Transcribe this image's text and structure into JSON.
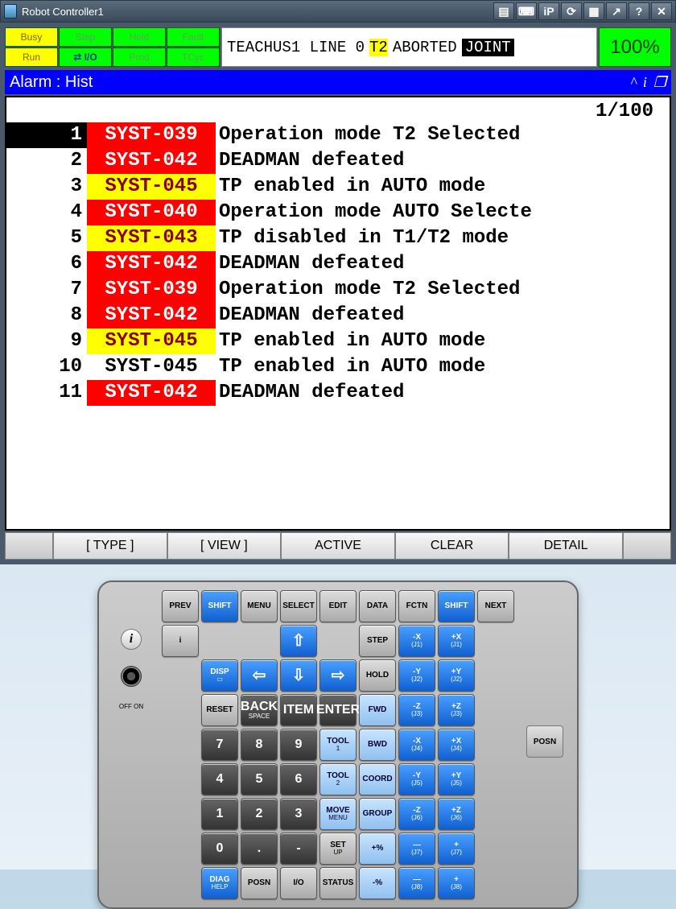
{
  "title": "Robot Controller1",
  "toolbar_icons": [
    "▤",
    "⌨",
    "iP",
    "⟳",
    "▦",
    "↗",
    "?",
    "✕"
  ],
  "status": {
    "grid": [
      {
        "label": "Busy",
        "cls": "yellow"
      },
      {
        "label": "Step",
        "cls": "dim"
      },
      {
        "label": "Hold",
        "cls": "dim"
      },
      {
        "label": "Fault",
        "cls": "dim"
      },
      {
        "label": "Run",
        "cls": "yellow"
      },
      {
        "label": "⇄ I/O",
        "cls": "active"
      },
      {
        "label": "Prod",
        "cls": "dim"
      },
      {
        "label": "TCyc",
        "cls": "dim"
      }
    ],
    "program": "TEACHUS1 LINE 0",
    "mode": "T2",
    "state": "ABORTED",
    "coord": "JOINT",
    "percent": "100%"
  },
  "header": "Alarm : Hist",
  "pager": "1/100",
  "alarms": [
    {
      "n": "1",
      "code": "SYST-039",
      "sev": "red",
      "msg": "Operation mode T2 Selected",
      "sel": true
    },
    {
      "n": "2",
      "code": "SYST-042",
      "sev": "red",
      "msg": "DEADMAN defeated"
    },
    {
      "n": "3",
      "code": "SYST-045",
      "sev": "yel",
      "msg": "TP enabled in AUTO mode"
    },
    {
      "n": "4",
      "code": "SYST-040",
      "sev": "red",
      "msg": "Operation mode AUTO Selecte"
    },
    {
      "n": "5",
      "code": "SYST-043",
      "sev": "yel",
      "msg": "TP disabled in T1/T2 mode"
    },
    {
      "n": "6",
      "code": "SYST-042",
      "sev": "red",
      "msg": "DEADMAN defeated"
    },
    {
      "n": "7",
      "code": "SYST-039",
      "sev": "red",
      "msg": "Operation mode T2 Selected"
    },
    {
      "n": "8",
      "code": "SYST-042",
      "sev": "red",
      "msg": "DEADMAN defeated"
    },
    {
      "n": "9",
      "code": "SYST-045",
      "sev": "yel",
      "msg": "TP enabled in AUTO mode"
    },
    {
      "n": "10",
      "code": "SYST-045",
      "sev": "none",
      "msg": "TP enabled in AUTO mode"
    },
    {
      "n": "11",
      "code": "SYST-042",
      "sev": "red",
      "msg": "DEADMAN defeated"
    }
  ],
  "actions": [
    "[ TYPE ]",
    "[ VIEW ]",
    "ACTIVE",
    "CLEAR",
    "DETAIL"
  ],
  "pendant": {
    "off_on": "OFF  ON",
    "posn": "POSN",
    "rows": [
      [
        "PREV|gray",
        "SHIFT|blue",
        "MENU|gray",
        "SELECT|gray",
        "EDIT|gray",
        "DATA|gray",
        "FCTN|gray",
        "SHIFT|blue",
        "NEXT|gray"
      ],
      [
        "i|gray",
        "",
        "",
        "⇧|blue arrow",
        "",
        "STEP|gray",
        "-X\n(J1)|blue",
        "+X\n(J1)|blue",
        ""
      ],
      [
        "",
        "DISP\n▭|blue",
        "⇦|blue arrow",
        "⇩|blue arrow",
        "⇨|blue arrow",
        "HOLD|gray",
        "-Y\n(J2)|blue",
        "+Y\n(J2)|blue",
        ""
      ],
      [
        "",
        "RESET|gray",
        "BACK\nSPACE|dark",
        "ITEM|dark",
        "ENTER|dark",
        "FWD|lblue",
        "-Z\n(J3)|blue",
        "+Z\n(J3)|blue",
        ""
      ],
      [
        "",
        "7|dark",
        "8|dark",
        "9|dark",
        "TOOL\n1|lblue",
        "BWD|lblue",
        "-X\n(J4)|blue",
        "+X\n(J4)|blue",
        ""
      ],
      [
        "",
        "4|dark",
        "5|dark",
        "6|dark",
        "TOOL\n2|lblue",
        "COORD|lblue",
        "-Y\n(J5)|blue",
        "+Y\n(J5)|blue",
        ""
      ],
      [
        "",
        "1|dark",
        "2|dark",
        "3|dark",
        "MOVE\nMENU|lblue",
        "GROUP|lblue",
        "-Z\n(J6)|blue",
        "+Z\n(J6)|blue",
        ""
      ],
      [
        "",
        "0|dark",
        ".|dark",
        "-|dark",
        "SET\nUP|gray",
        "+%|lblue",
        "—\n(J7)|blue",
        "+\n(J7)|blue",
        ""
      ],
      [
        "",
        "DIAG\nHELP|blue",
        "POSN|gray",
        "I/O|gray",
        "STATUS|gray",
        "-%|lblue",
        "—\n(J8)|blue",
        "+\n(J8)|blue",
        ""
      ]
    ]
  }
}
